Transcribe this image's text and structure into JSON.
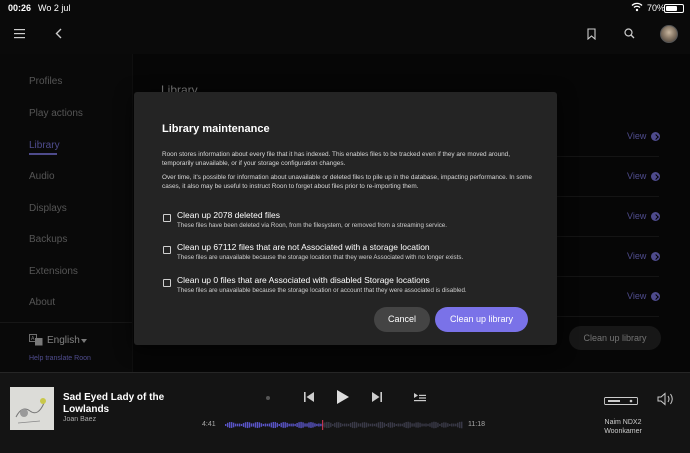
{
  "status_bar": {
    "time": "00:26",
    "date": "Wo 2 jul",
    "battery": "70%",
    "battery_level": 0.7
  },
  "topbar": {
    "icons": [
      "hamburger-icon",
      "back-icon",
      "bookmark-icon",
      "search-icon",
      "avatar"
    ]
  },
  "sidebar": {
    "items": [
      {
        "label": "Profiles",
        "active": false
      },
      {
        "label": "Play actions",
        "active": false
      },
      {
        "label": "Library",
        "active": true
      },
      {
        "label": "Audio",
        "active": false
      },
      {
        "label": "Displays",
        "active": false
      },
      {
        "label": "Backups",
        "active": false
      },
      {
        "label": "Extensions",
        "active": false
      },
      {
        "label": "About",
        "active": false
      }
    ],
    "language": "English",
    "help_link": "Help translate Roon"
  },
  "main": {
    "title": "Library",
    "view_links": [
      "View",
      "View",
      "View",
      "View",
      "View"
    ],
    "cleanup_button": "Clean up library"
  },
  "modal": {
    "title": "Library maintenance",
    "paragraph1": "Roon stores information about every file that it has indexed. This enables files to be tracked even if they are moved around, temporarily unavailable, or if your storage configuration changes.",
    "paragraph2": "Over time, it's possible for information about unavailable or deleted files to pile up in the database, impacting performance. In some cases, it also may be useful to instruct Roon to forget about files prior to re-importing them.",
    "options": [
      {
        "title": "Clean up 2078 deleted files",
        "desc": "These files have been deleted via Roon, from the filesystem, or removed from a streaming service.",
        "checked": false
      },
      {
        "title": "Clean up 67112 files that are not Associated with a storage location",
        "desc": "These files are unavailable because the storage location that they were Associated with no longer exists.",
        "checked": false
      },
      {
        "title": "Clean up 0 files that are Associated with disabled Storage locations",
        "desc": "These files are unavailable because the storage location or account that they were associated is disabled.",
        "checked": false
      }
    ],
    "cancel_label": "Cancel",
    "confirm_label": "Clean up library"
  },
  "player": {
    "track_title": "Sad Eyed Lady of the Lowlands",
    "artist": "Joan Baez",
    "elapsed": "4:41",
    "duration": "11:18",
    "progress": 0.41,
    "zone_device": "Naim NDX2",
    "zone_room": "Woonkamer"
  },
  "colors": {
    "accent": "#8e89ff",
    "primary_button": "#7a72e8",
    "modal_bg": "#242424"
  }
}
